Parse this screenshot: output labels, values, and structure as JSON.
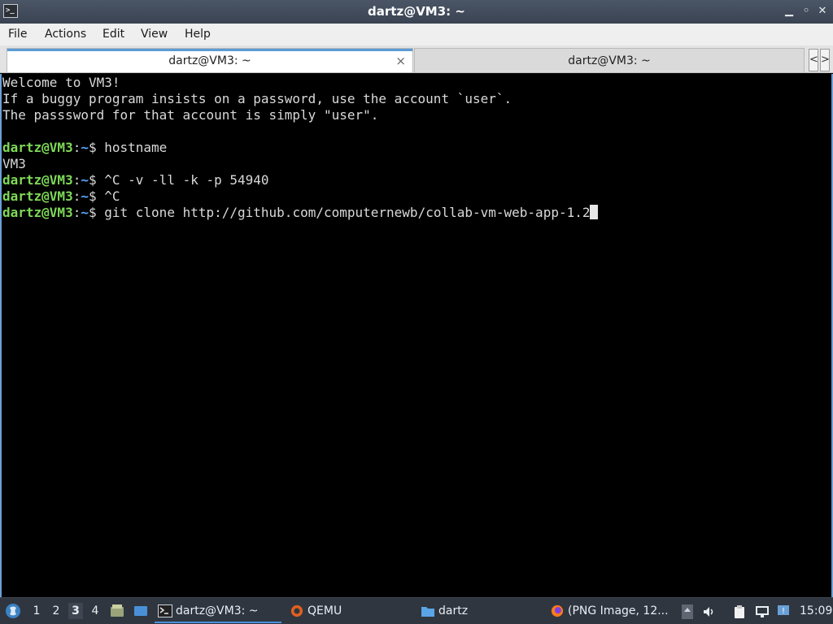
{
  "window": {
    "title": "dartz@VM3: ~",
    "controls": {
      "minimize": "▁",
      "restore": "◦",
      "close": "✕"
    }
  },
  "menu": [
    "File",
    "Actions",
    "Edit",
    "View",
    "Help"
  ],
  "tabs": [
    {
      "label": "dartz@VM3: ~",
      "active": true,
      "close_icon": "×"
    },
    {
      "label": "dartz@VM3: ~",
      "active": false
    }
  ],
  "tab_nav": {
    "prev": "<",
    "next": ">"
  },
  "terminal": {
    "lines": [
      "Welcome to VM3!",
      "If a buggy program insists on a password, use the account `user`.",
      "The passsword for that account is simply \"user\"."
    ],
    "prompt_user": "dartz@VM3",
    "prompt_sep": ":",
    "prompt_path": "~",
    "prompt_sym": "$ ",
    "commands": [
      {
        "cmd": "hostname",
        "output": "VM3"
      },
      {
        "cmd": "^C -v -ll -k -p 54940"
      },
      {
        "cmd": "^C"
      },
      {
        "cmd": "git clone http://github.com/computernewb/collab-vm-web-app-1.2"
      }
    ]
  },
  "taskbar": {
    "workspaces": [
      "1",
      "2",
      "3",
      "4"
    ],
    "active_workspace": "3",
    "tasks": [
      {
        "label": "dartz@VM3: ~",
        "icon": "terminal-icon",
        "active": true
      },
      {
        "label": "QEMU",
        "icon": "qemu-icon"
      },
      {
        "label": "dartz",
        "icon": "folder-icon"
      },
      {
        "label": "(PNG Image, 12...",
        "icon": "firefox-icon"
      }
    ],
    "clock": "15:09"
  },
  "colors": {
    "prompt_user": "#7ed957",
    "prompt_path": "#5aa5ff",
    "accent": "#5b9bd5"
  }
}
